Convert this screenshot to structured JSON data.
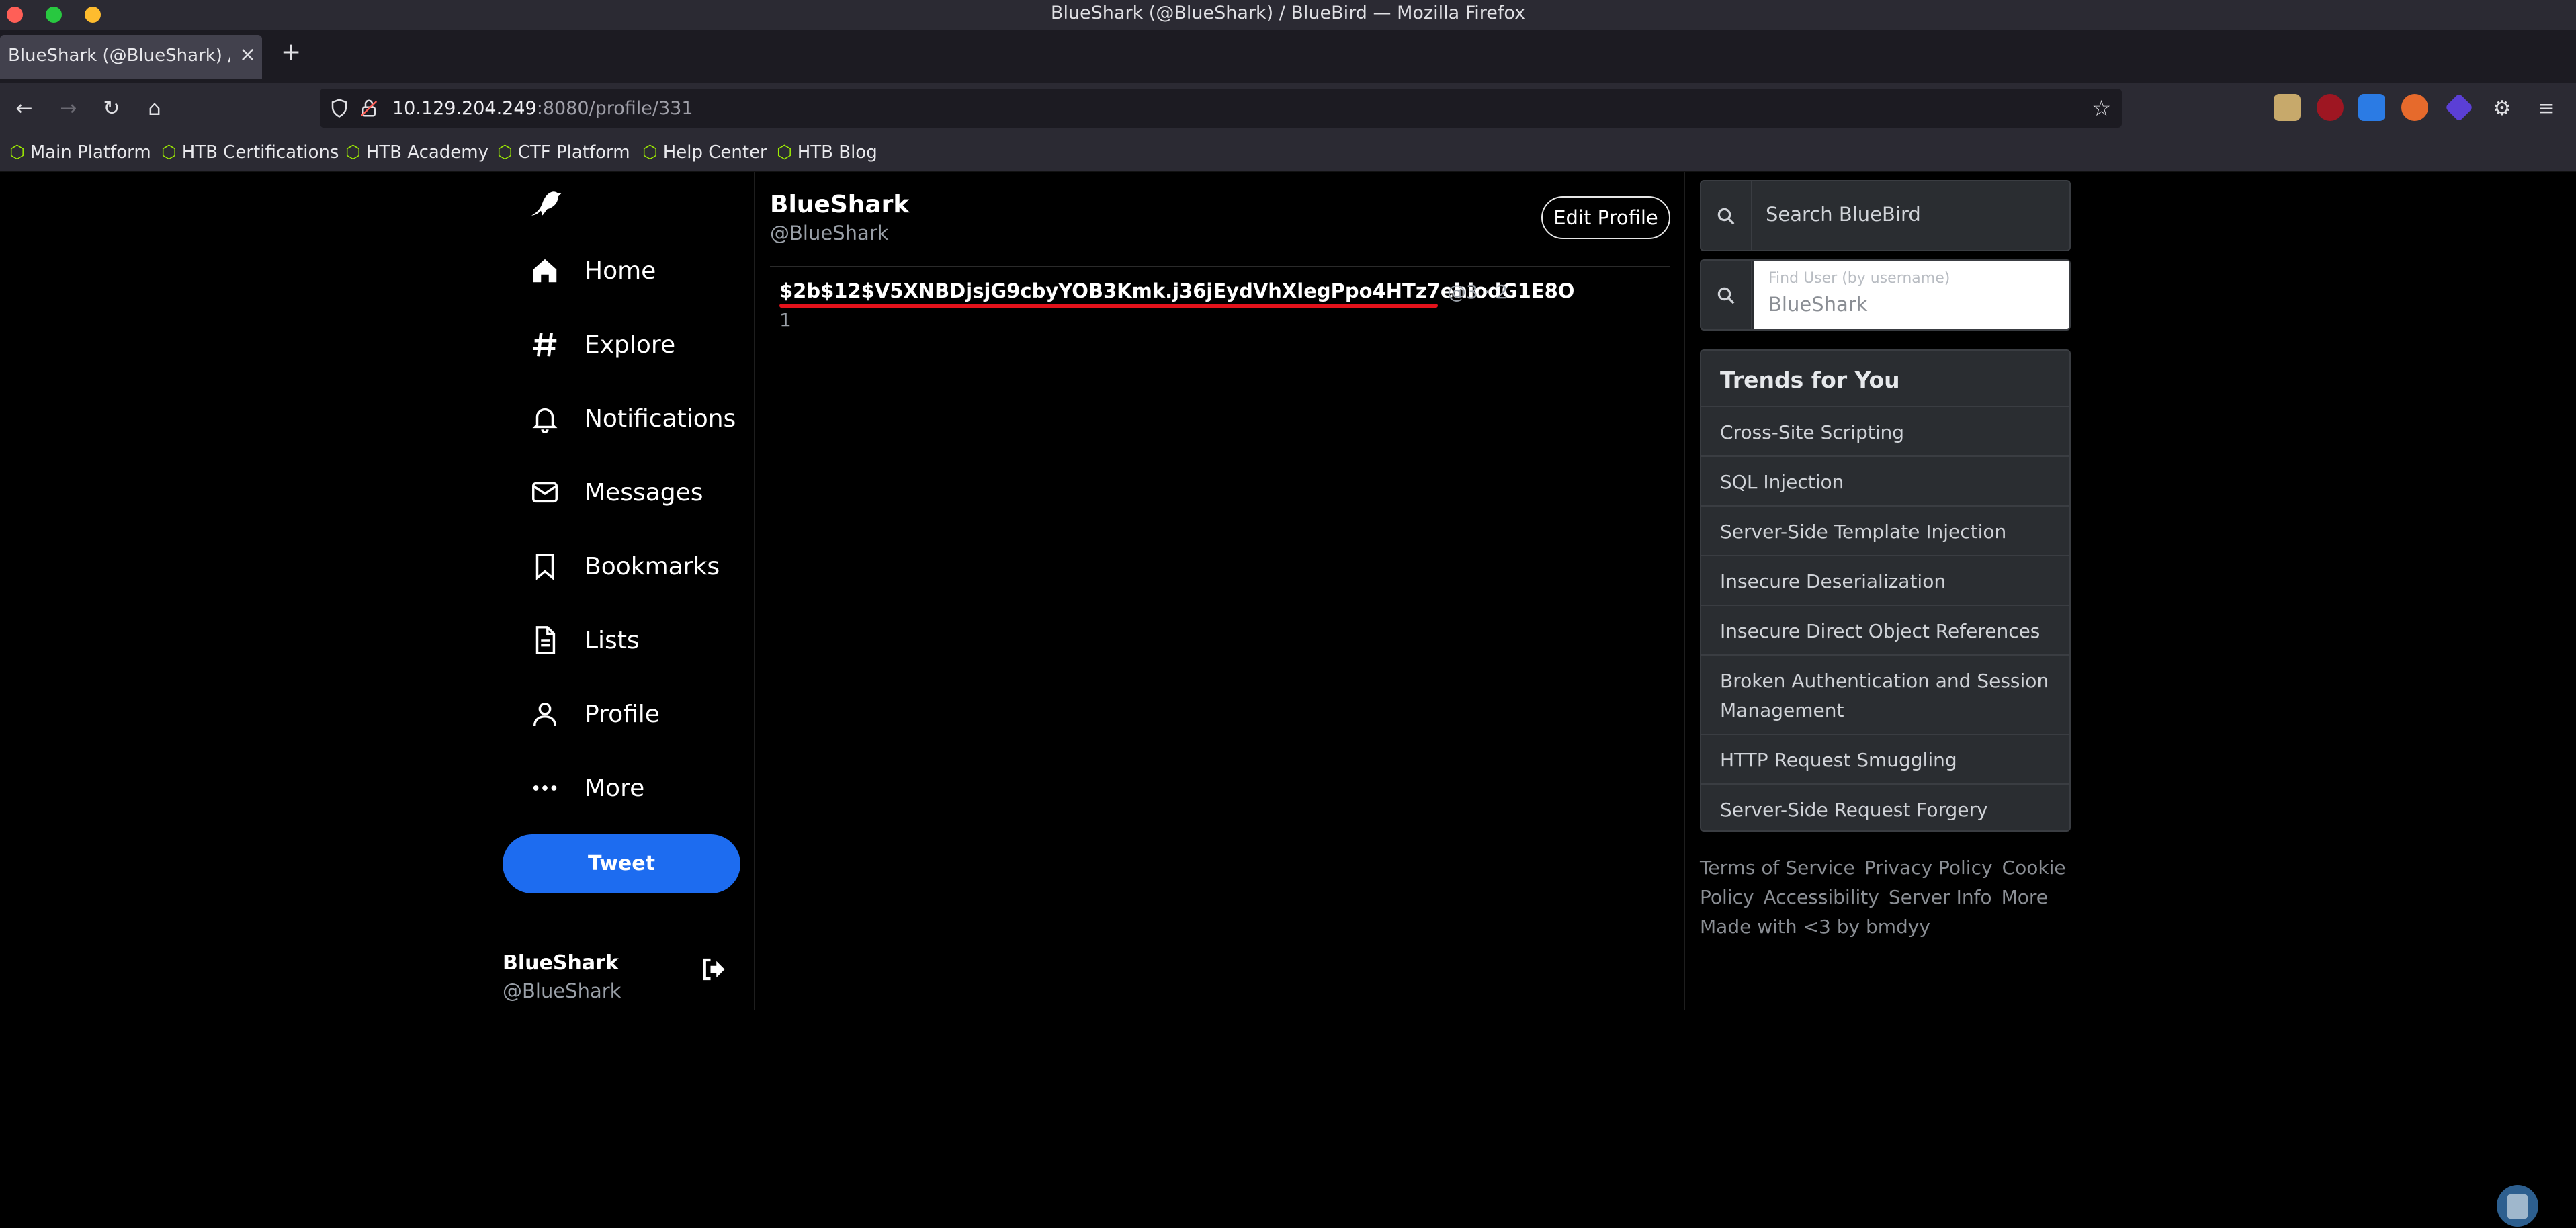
{
  "browser": {
    "window_title": "BlueShark (@BlueShark) / BlueBird — Mozilla Firefox",
    "tab_title": "BlueShark (@BlueShark) / BlueBird",
    "url_host": "10.129.204.249",
    "url_rest": ":8080/profile/331",
    "bookmarks": [
      "Main Platform",
      "HTB Certifications",
      "HTB Academy",
      "CTF Platform",
      "Help Center",
      "HTB Blog"
    ]
  },
  "nav": {
    "items": [
      "Home",
      "Explore",
      "Notifications",
      "Messages",
      "Bookmarks",
      "Lists",
      "Profile",
      "More"
    ],
    "tweet_label": "Tweet"
  },
  "account": {
    "name": "BlueShark",
    "handle": "@BlueShark"
  },
  "profile": {
    "name": "BlueShark",
    "handle": "@BlueShark",
    "edit_label": "Edit Profile"
  },
  "tweet": {
    "text": "$2b$12$V5XNBDjsjG9cbyYOB3Kmk.j36jEydVhXlegPpo4HTz7ehiodG1E8O",
    "meta": "@3 · 2",
    "line2": "1"
  },
  "sidebar": {
    "search_placeholder": "Search BlueBird",
    "find_user_label": "Find User (by username)",
    "find_user_value": "BlueShark",
    "trends_title": "Trends for You",
    "trends": [
      "Cross-Site Scripting",
      "SQL Injection",
      "Server-Side Template Injection",
      "Insecure Deserialization",
      "Insecure Direct Object References",
      "Broken Authentication and Session Management",
      "HTTP Request Smuggling",
      "Server-Side Request Forgery"
    ],
    "footer_links": [
      "Terms of Service",
      "Privacy Policy",
      "Cookie Policy",
      "Accessibility",
      "Server Info",
      "More"
    ],
    "footer_note": "Made with <3 by bmdyy"
  },
  "colors": {
    "accent": "#1d6cf0",
    "highlight_underline": "#e3121b",
    "htb_green": "#9fef00"
  }
}
